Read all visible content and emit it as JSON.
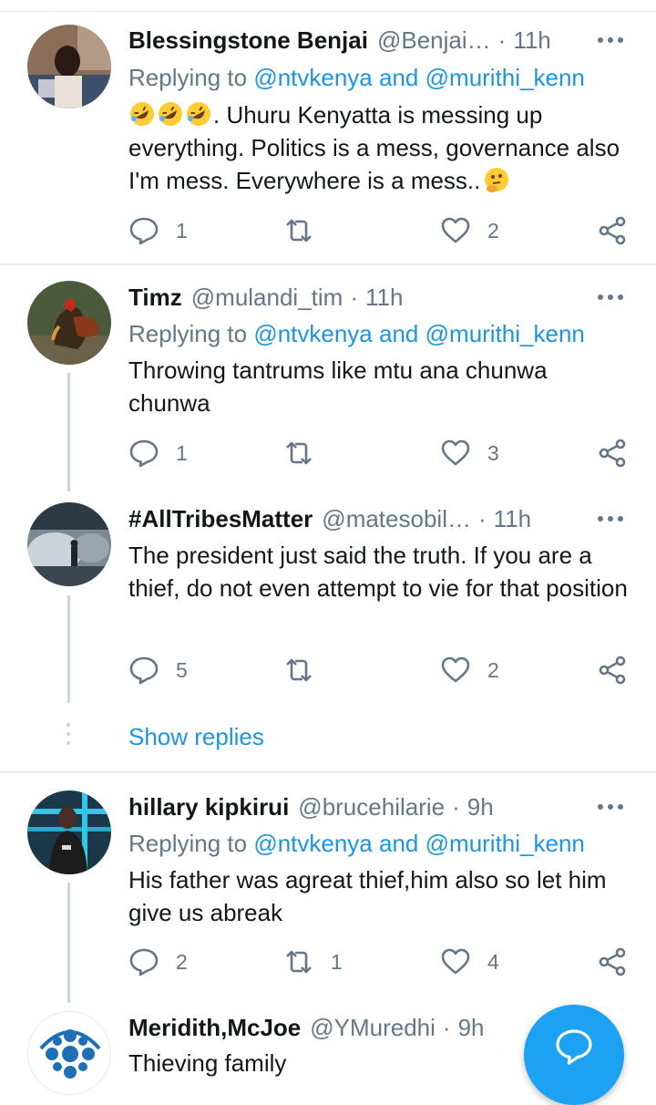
{
  "colors": {
    "accent": "#1da1f2",
    "link": "#1b95e0",
    "muted": "#657786",
    "divider": "#e6ecf0"
  },
  "tweets": [
    {
      "name": "Blessingstone Benjai",
      "handle": "@Benjai…",
      "dot": "·",
      "time": "11h",
      "reply_prefix": "Replying to",
      "mention1": "@ntvkenya",
      "reply_and": "and",
      "mention2": "@murithi_kenn",
      "text": ". Uhuru Kenyatta is messing up everything. Politics is a mess, governance also I'm mess. Everywhere is a mess..",
      "emoji_prefix": [
        "rolling-on-floor-laughing-emoji",
        "rolling-on-floor-laughing-emoji",
        "rolling-on-floor-laughing-emoji"
      ],
      "emoji_suffix": "thinking-face-emoji",
      "replies": "1",
      "retweets": "",
      "likes": "2"
    },
    {
      "name": "Timz",
      "handle": "@mulandi_tim",
      "dot": "·",
      "time": "11h",
      "reply_prefix": "Replying to",
      "mention1": "@ntvkenya",
      "reply_and": "and",
      "mention2": "@murithi_kenn",
      "text": "Throwing tantrums like mtu ana chunwa chunwa",
      "replies": "1",
      "retweets": "",
      "likes": "3"
    },
    {
      "name": "#AllTribesMatter",
      "handle": "@matesobil…",
      "dot": "·",
      "time": "11h",
      "text": "The president just said the truth. If you are a thief, do not even attempt to vie for that position",
      "replies": "5",
      "retweets": "",
      "likes": "2"
    },
    {
      "name": "hillary kipkirui",
      "handle": "@brucehilarie",
      "dot": "·",
      "time": "9h",
      "reply_prefix": "Replying to",
      "mention1": "@ntvkenya",
      "reply_and": "and",
      "mention2": "@murithi_kenn",
      "text": "His father was agreat thief,him also so let him give us abreak",
      "replies": "2",
      "retweets": "1",
      "likes": "4"
    },
    {
      "name": "Meridith,McJoe",
      "handle": "@YMuredhi",
      "dot": "·",
      "time": "9h",
      "text": "Thieving family"
    }
  ],
  "show_replies": "Show replies",
  "icons": {
    "reply": "reply-icon",
    "retweet": "retweet-icon",
    "like": "heart-icon",
    "share": "share-icon",
    "more": "more-options-icon",
    "compose": "compose-reply-icon"
  }
}
